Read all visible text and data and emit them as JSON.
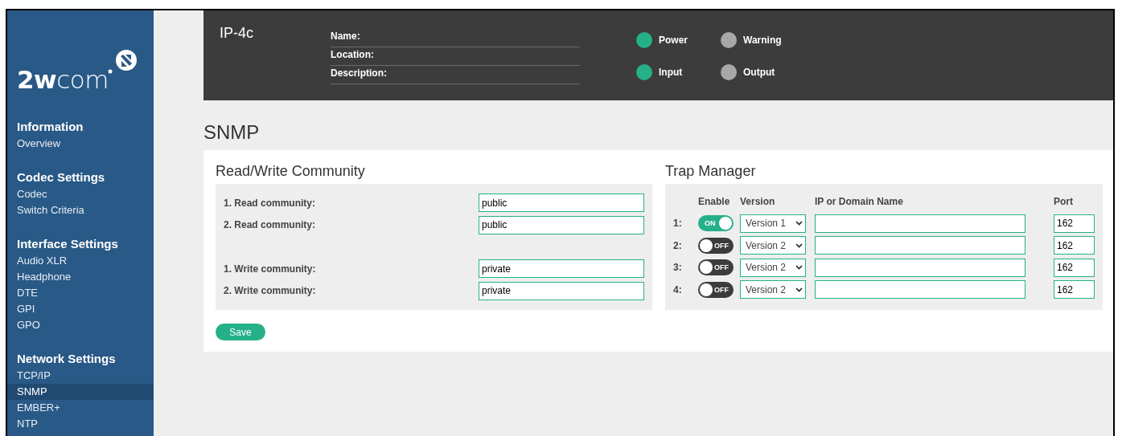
{
  "sidebar": {
    "logo": "**2w**com",
    "groups": [
      {
        "title": "Information",
        "items": [
          {
            "label": "Overview",
            "selected": false
          }
        ]
      },
      {
        "title": "Codec Settings",
        "items": [
          {
            "label": "Codec",
            "selected": false
          },
          {
            "label": "Switch Criteria",
            "selected": false
          }
        ]
      },
      {
        "title": "Interface Settings",
        "items": [
          {
            "label": "Audio XLR",
            "selected": false
          },
          {
            "label": "Headphone",
            "selected": false
          },
          {
            "label": "DTE",
            "selected": false
          },
          {
            "label": "GPI",
            "selected": false
          },
          {
            "label": "GPO",
            "selected": false
          }
        ]
      },
      {
        "title": "Network Settings",
        "items": [
          {
            "label": "TCP/IP",
            "selected": false
          },
          {
            "label": "SNMP",
            "selected": true
          },
          {
            "label": "EMBER+",
            "selected": false
          },
          {
            "label": "NTP",
            "selected": false
          }
        ]
      }
    ]
  },
  "header": {
    "device": "IP-4c",
    "fields": [
      {
        "label": "Name:"
      },
      {
        "label": "Location:"
      },
      {
        "label": "Description:"
      }
    ],
    "indicators": [
      {
        "label": "Power",
        "color": "#26b08a"
      },
      {
        "label": "Warning",
        "color": "#a8a8a8"
      },
      {
        "label": "Input",
        "color": "#26b08a"
      },
      {
        "label": "Output",
        "color": "#a8a8a8"
      }
    ]
  },
  "page_title": "SNMP",
  "community": {
    "title": "Read/Write Community",
    "read_rows": [
      {
        "label": "1. Read community:",
        "value": "public"
      },
      {
        "label": "2. Read community:",
        "value": "public"
      }
    ],
    "write_rows": [
      {
        "label": "1. Write community:",
        "value": "private"
      },
      {
        "label": "2. Write community:",
        "value": "private"
      }
    ],
    "save_button": "Save"
  },
  "trap_manager": {
    "title": "Trap Manager",
    "columns": [
      "Enable",
      "Version",
      "IP or Domain Name",
      "Port"
    ],
    "rows": [
      {
        "index": "1:",
        "enabled": true,
        "toggle_text": "ON",
        "version": "Version 1",
        "port": "162"
      },
      {
        "index": "2:",
        "enabled": false,
        "toggle_text": "OFF",
        "version": "Version 2",
        "port": "162"
      },
      {
        "index": "3:",
        "enabled": false,
        "toggle_text": "OFF",
        "version": "Version 2",
        "port": "162"
      },
      {
        "index": "4:",
        "enabled": false,
        "toggle_text": "OFF",
        "version": "Version 2",
        "port": "162"
      }
    ]
  }
}
